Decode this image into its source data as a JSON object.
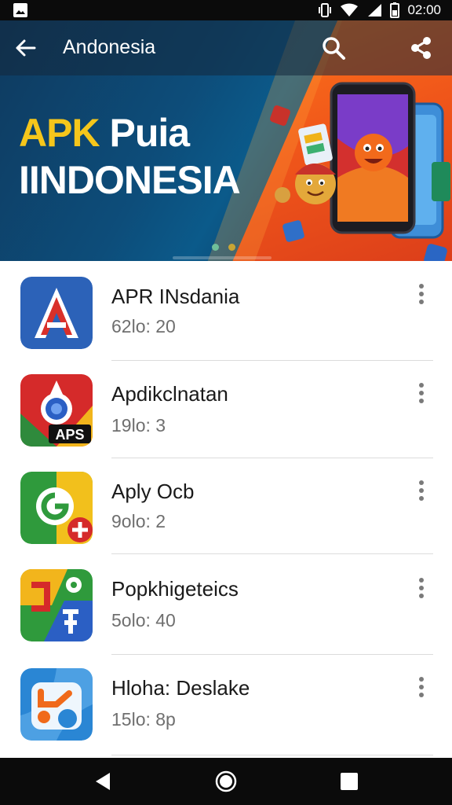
{
  "status_bar": {
    "time": "02:00",
    "icons": [
      "image-notification-icon",
      "vibrate-icon",
      "wifi-icon",
      "battery-icon"
    ]
  },
  "toolbar": {
    "title": "Andonesia",
    "back_icon": "arrow-back-icon",
    "search_icon": "search-icon",
    "share_icon": "share-icon"
  },
  "banner": {
    "line1_a": "APK",
    "line1_b": "Puia",
    "line2": "IINDONESIA"
  },
  "apps": [
    {
      "name": "APR INsdania",
      "meta": "62lo: 20"
    },
    {
      "name": "Apdikclnatan",
      "meta": "19lo: 3"
    },
    {
      "name": "Aply Ocb",
      "meta": "9olo: 2"
    },
    {
      "name": "Popkhigeteics",
      "meta": "5olo: 40"
    },
    {
      "name": "Hloha: Deslake",
      "meta": "15lo: 8p"
    }
  ],
  "app_icon_text": {
    "aps": "APS"
  },
  "colors": {
    "accent_yellow": "#f5c61b",
    "banner_blue": "#0d4d7a",
    "banner_orange": "#f0561a",
    "text_primary": "#1a1a1a",
    "text_secondary": "#6f6f6f"
  },
  "nav_bar": {
    "icons": [
      "back-triangle-icon",
      "home-circle-icon",
      "recents-square-icon"
    ]
  }
}
